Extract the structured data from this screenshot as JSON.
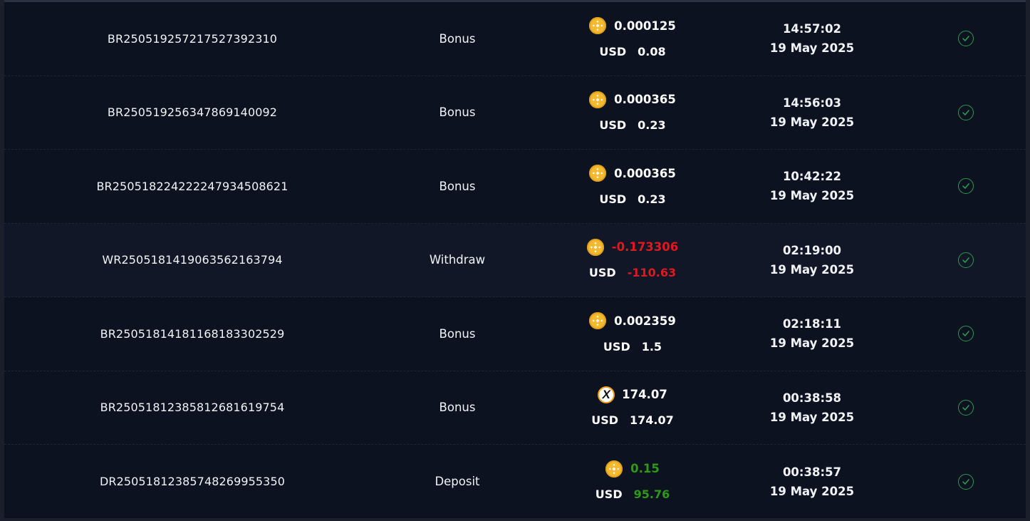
{
  "transactions": [
    {
      "id": "BR250519257217527392310",
      "type": "Bonus",
      "coin": "bnb-icon",
      "crypto": "0.000125",
      "usd_label": "USD",
      "usd": "0.08",
      "sign": "neutral",
      "time": "14:57:02",
      "date": "19 May 2025",
      "status": "check-circle-icon"
    },
    {
      "id": "BR250519256347869140092",
      "type": "Bonus",
      "coin": "bnb-icon",
      "crypto": "0.000365",
      "usd_label": "USD",
      "usd": "0.23",
      "sign": "neutral",
      "time": "14:56:03",
      "date": "19 May 2025",
      "status": "check-circle-icon"
    },
    {
      "id": "BR250518224222247934508621",
      "type": "Bonus",
      "coin": "bnb-icon",
      "crypto": "0.000365",
      "usd_label": "USD",
      "usd": "0.23",
      "sign": "neutral",
      "time": "10:42:22",
      "date": "19 May 2025",
      "status": "check-circle-icon"
    },
    {
      "id": "WR250518141906356216379​4",
      "type": "Withdraw",
      "coin": "bnb-icon",
      "crypto": "-0.173306",
      "usd_label": "USD",
      "usd": "-110.63",
      "sign": "negative",
      "time": "02:19:00",
      "date": "19 May 2025",
      "status": "check-circle-icon"
    },
    {
      "id": "BR250518141811681833025​29",
      "type": "Bonus",
      "coin": "bnb-icon",
      "crypto": "0.002359",
      "usd_label": "USD",
      "usd": "1.5",
      "sign": "neutral",
      "time": "02:18:11",
      "date": "19 May 2025",
      "status": "check-circle-icon"
    },
    {
      "id": "BR250518123858126816197​54",
      "type": "Bonus",
      "coin": "x-token-icon",
      "crypto": "174.07",
      "usd_label": "USD",
      "usd": "174.07",
      "sign": "neutral",
      "time": "00:38:58",
      "date": "19 May 2025",
      "status": "check-circle-icon"
    },
    {
      "id": "DR250518123857482699553​50",
      "type": "Deposit",
      "coin": "bnb-icon",
      "crypto": "0.15",
      "usd_label": "USD",
      "usd": "95.76",
      "sign": "positive",
      "time": "00:38:57",
      "date": "19 May 2025",
      "status": "check-circle-icon"
    }
  ],
  "colors": {
    "background": "#0c1220",
    "negative": "#e0191e",
    "positive": "#2e9a18",
    "success_check": "#2b9a4c",
    "bnb_coin": "#f3ba2f"
  }
}
